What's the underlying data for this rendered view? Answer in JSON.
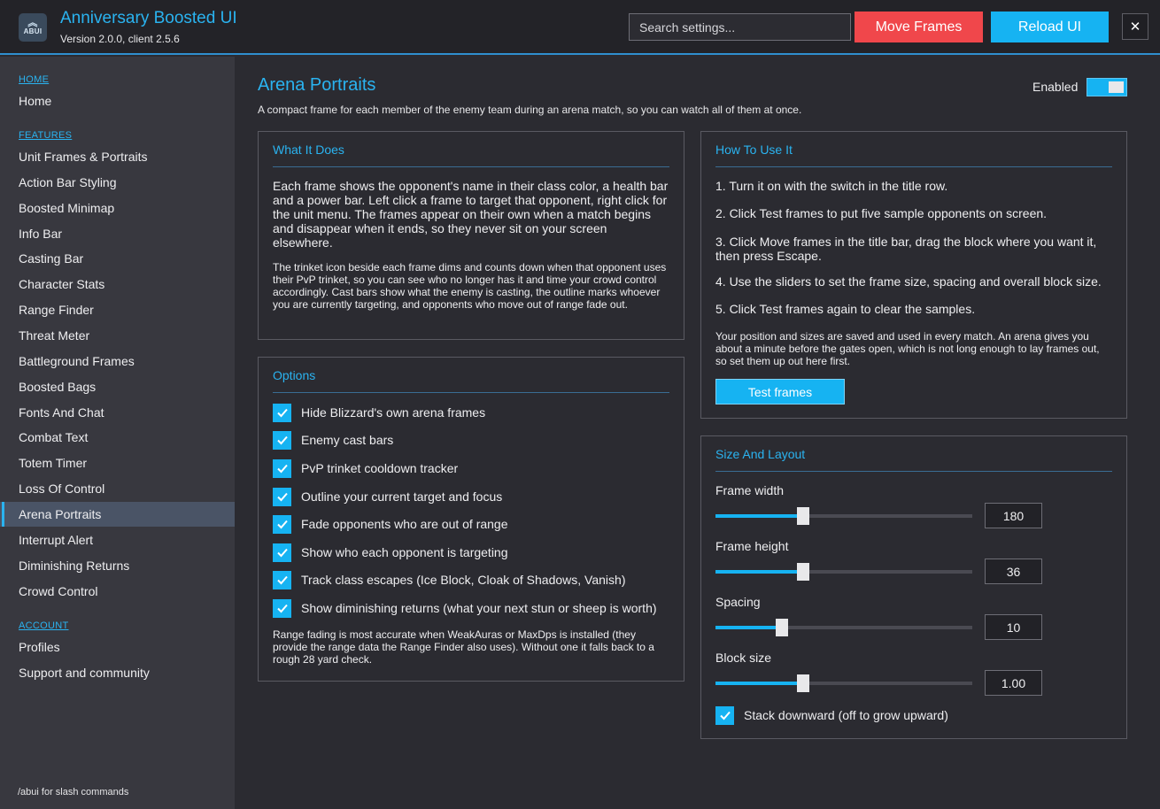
{
  "app": {
    "logo_text": "ABUI",
    "title": "Anniversary Boosted UI",
    "version": "Version 2.0.0, client 2.5.6",
    "search_placeholder": "Search settings...",
    "move_frames_label": "Move Frames",
    "reload_ui_label": "Reload UI",
    "close_label": "✕",
    "colors": {
      "accent": "#2ab3f0",
      "danger": "#f0474b",
      "primary_button": "#16b3f2"
    }
  },
  "sidebar": {
    "categories": [
      {
        "label": "HOME",
        "items": [
          "Home"
        ]
      },
      {
        "label": "FEATURES",
        "items": [
          "Unit Frames & Portraits",
          "Action Bar Styling",
          "Boosted Minimap",
          "Info Bar",
          "Casting Bar",
          "Character Stats",
          "Range Finder",
          "Threat Meter",
          "Battleground Frames",
          "Boosted Bags",
          "Fonts And Chat",
          "Combat Text",
          "Totem Timer",
          "Loss Of Control",
          "Arena Portraits",
          "Interrupt Alert",
          "Diminishing Returns",
          "Crowd Control"
        ]
      },
      {
        "label": "ACCOUNT",
        "items": [
          "Profiles",
          "Support and community"
        ]
      }
    ],
    "active_item": "Arena Portraits",
    "footer": "/abui for slash commands"
  },
  "page": {
    "title": "Arena Portraits",
    "description": "A compact frame for each member of the enemy team during an arena match, so you can watch all of them at once.",
    "enabled_label": "Enabled",
    "enabled": true
  },
  "what_it_does": {
    "title": "What It Does",
    "para1": "Each frame shows the opponent's name in their class color, a health bar and a power bar.  Left click a frame to target that opponent, right click for the unit menu.  The frames appear on their own when a match begins and disappear when it ends, so they never sit on your screen elsewhere.",
    "para2": "The trinket icon beside each frame dims and counts down when that opponent uses their PvP trinket, so you can see who no longer has it and time your crowd control accordingly.  Cast bars show what the enemy is casting, the outline marks whoever you are currently targeting, and opponents who move out of range fade out."
  },
  "options": {
    "title": "Options",
    "items": [
      {
        "label": "Hide Blizzard's own arena frames",
        "checked": true
      },
      {
        "label": "Enemy cast bars",
        "checked": true
      },
      {
        "label": "PvP trinket cooldown tracker",
        "checked": true
      },
      {
        "label": "Outline your current target and focus",
        "checked": true
      },
      {
        "label": "Fade opponents who are out of range",
        "checked": true
      },
      {
        "label": "Show who each opponent is targeting",
        "checked": true
      },
      {
        "label": "Track class escapes (Ice Block, Cloak of Shadows, Vanish)",
        "checked": true
      },
      {
        "label": "Show diminishing returns (what your next stun or sheep is worth)",
        "checked": true
      }
    ],
    "note": "Range fading is most accurate when WeakAuras or MaxDps is installed (they provide the range data the Range Finder also uses).  Without one it falls back to a rough 28 yard check."
  },
  "how_to_use": {
    "title": "How To Use It",
    "steps": [
      "1.  Turn it on with the switch in the title row.",
      "2.  Click Test frames to put five sample opponents on screen.",
      "3.  Click Move frames in the title bar, drag the block where you want it, then press Escape.",
      "4.  Use the sliders to set the frame size, spacing and overall block size.",
      "5.  Click Test frames again to clear the samples."
    ],
    "note": "Your position and sizes are saved and used in every match.  An arena gives you about a minute before the gates open, which is not long enough to lay frames out, so set them up out here first.",
    "test_button": "Test frames"
  },
  "size_layout": {
    "title": "Size And Layout",
    "sliders": [
      {
        "label": "Frame width",
        "value": "180",
        "fraction": 0.34
      },
      {
        "label": "Frame height",
        "value": "36",
        "fraction": 0.34
      },
      {
        "label": "Spacing",
        "value": "10",
        "fraction": 0.26
      },
      {
        "label": "Block size",
        "value": "1.00",
        "fraction": 0.34
      }
    ],
    "stack_label": "Stack downward (off to grow upward)",
    "stack_checked": true
  }
}
